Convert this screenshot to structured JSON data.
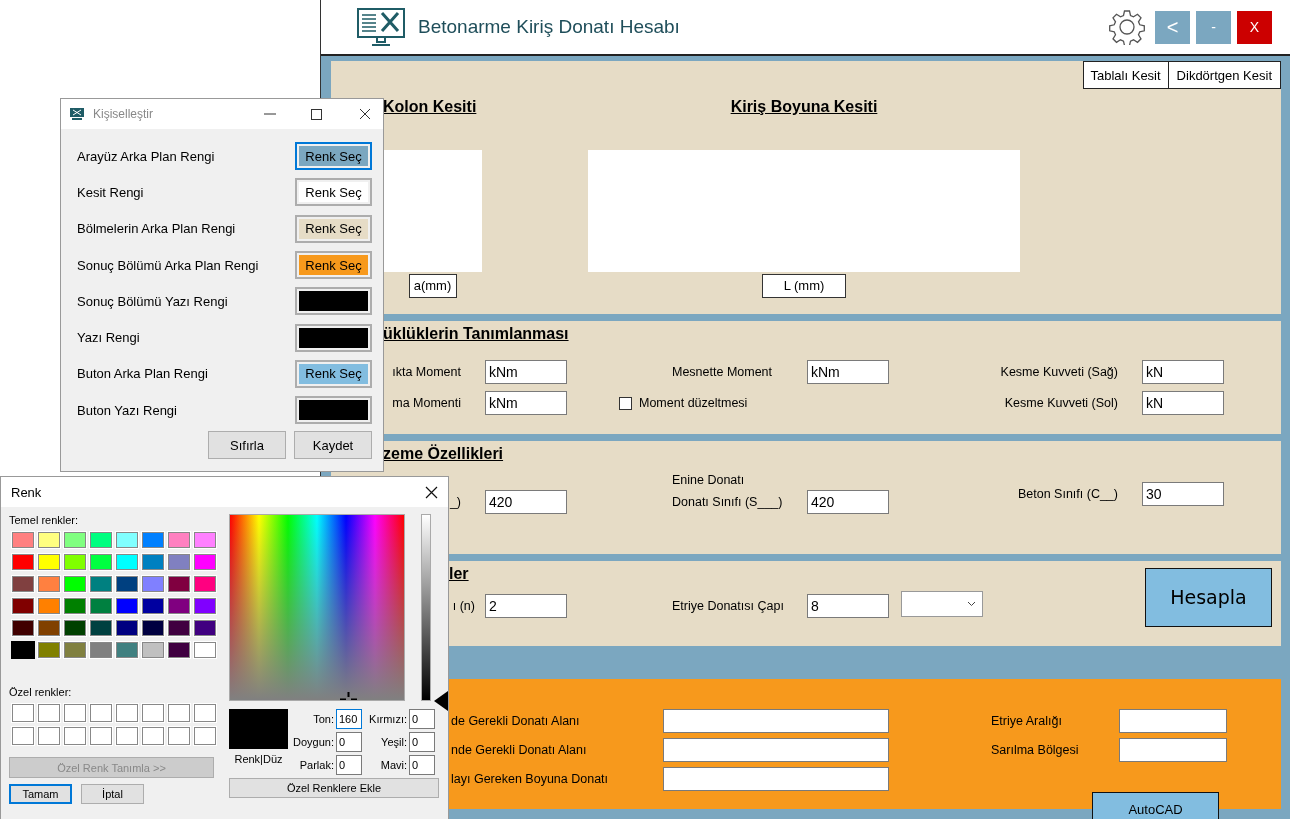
{
  "main_window": {
    "title": "Betonarme Kiriş Donatı Hesabı",
    "window_buttons": [
      {
        "kind": "back",
        "label": "<"
      },
      {
        "kind": "minimize",
        "label": "-"
      },
      {
        "kind": "close",
        "label": "X"
      }
    ],
    "section_types": [
      {
        "label": "Tablalı Kesit"
      },
      {
        "label": "Dikdörtgen Kesit"
      }
    ],
    "sections": {
      "column_title": "Kolon Kesiti",
      "column_dimension": "a(mm)",
      "beam_title": "Kiriş Boyuna Kesiti",
      "beam_dimension": "L (mm)"
    },
    "loads": {
      "title": "üklüklerin Tanımlanması",
      "span_moment": {
        "label": "ıkta Moment",
        "value": "kNm"
      },
      "torsion_moment": {
        "label": "ma Momenti",
        "value": "kNm"
      },
      "support_moment": {
        "label": "Mesnette Moment",
        "value": "kNm"
      },
      "shear_right": {
        "label": "Kesme Kuvveti (Sağ)",
        "value": "kN"
      },
      "shear_left": {
        "label": "Kesme Kuvveti (Sol)",
        "value": "kN"
      },
      "moment_correction": {
        "label": "Moment düzeltmesi",
        "checked": false
      }
    },
    "materials": {
      "title": "zeme Özellikleri",
      "longitudinal": {
        "label": "_)",
        "value": "420"
      },
      "transverse_heading": "Enine Donatı",
      "transverse": {
        "label": "Donatı Sınıfı (S___)",
        "value": "420"
      },
      "concrete": {
        "label": "Beton Sınıfı (C__)",
        "value": "30"
      }
    },
    "rebars": {
      "title": "ler",
      "count": {
        "label": "ı (n)",
        "value": "2"
      },
      "stirrup_diameter": {
        "label": "Etriye Donatısı Çapı",
        "value": "8"
      },
      "calculate_button": "Hesapla"
    },
    "results": {
      "labels": [
        "de Gerekli Donatı Alanı",
        "nde Gerekli Donatı Alanı",
        "layı Gereken Boyuna Donatı"
      ],
      "right_labels": [
        "Etriye Aralığı",
        "Sarılma Bölgesi"
      ],
      "autocad_button": "AutoCAD"
    }
  },
  "customize_dialog": {
    "title": "Kişiselleştir",
    "rows": [
      {
        "label": "Arayüz Arka Plan Rengi",
        "button": "Renk Seç",
        "color": "#7ba7c0",
        "focused": true
      },
      {
        "label": "Kesit Rengi",
        "button": "Renk Seç",
        "color": "#ffffff",
        "focused": false
      },
      {
        "label": "Bölmelerin Arka Plan Rengi",
        "button": "Renk Seç",
        "color": "#e6dcc6",
        "focused": false
      },
      {
        "label": "Sonuç Bölümü Arka Plan Rengi",
        "button": "Renk Seç",
        "color": "#f7991c",
        "focused": false
      },
      {
        "label": "Sonuç Bölümü Yazı Rengi",
        "color": "#000000",
        "focused": false
      },
      {
        "label": "Yazı Rengi",
        "color": "#000000",
        "focused": false
      },
      {
        "label": "Buton Arka Plan Rengi",
        "button": "Renk Seç",
        "color": "#82bde0",
        "focused": false
      },
      {
        "label": "Buton Yazı Rengi",
        "color": "#000000",
        "focused": false
      }
    ],
    "buttons": [
      "Sıfırla",
      "Kaydet"
    ]
  },
  "color_dialog": {
    "title": "Renk",
    "basic_label": "Temel renkler:",
    "basic_colors": [
      {
        "color": "#ff8080",
        "selected": false
      },
      {
        "color": "#ffff80",
        "selected": false
      },
      {
        "color": "#80ff80",
        "selected": false
      },
      {
        "color": "#00ff80",
        "selected": false
      },
      {
        "color": "#80ffff",
        "selected": false
      },
      {
        "color": "#0080ff",
        "selected": false
      },
      {
        "color": "#ff80c0",
        "selected": false
      },
      {
        "color": "#ff80ff",
        "selected": false
      },
      {
        "color": "#ff0000",
        "selected": false
      },
      {
        "color": "#ffff00",
        "selected": false
      },
      {
        "color": "#80ff00",
        "selected": false
      },
      {
        "color": "#00ff40",
        "selected": false
      },
      {
        "color": "#00ffff",
        "selected": false
      },
      {
        "color": "#0080c0",
        "selected": false
      },
      {
        "color": "#8080c0",
        "selected": false
      },
      {
        "color": "#ff00ff",
        "selected": false
      },
      {
        "color": "#804040",
        "selected": false
      },
      {
        "color": "#ff8040",
        "selected": false
      },
      {
        "color": "#00ff00",
        "selected": false
      },
      {
        "color": "#008080",
        "selected": false
      },
      {
        "color": "#004080",
        "selected": false
      },
      {
        "color": "#8080ff",
        "selected": false
      },
      {
        "color": "#800040",
        "selected": false
      },
      {
        "color": "#ff0080",
        "selected": false
      },
      {
        "color": "#800000",
        "selected": false
      },
      {
        "color": "#ff8000",
        "selected": false
      },
      {
        "color": "#008000",
        "selected": false
      },
      {
        "color": "#008040",
        "selected": false
      },
      {
        "color": "#0000ff",
        "selected": false
      },
      {
        "color": "#0000a0",
        "selected": false
      },
      {
        "color": "#800080",
        "selected": false
      },
      {
        "color": "#8000ff",
        "selected": false
      },
      {
        "color": "#400000",
        "selected": false
      },
      {
        "color": "#804000",
        "selected": false
      },
      {
        "color": "#004000",
        "selected": false
      },
      {
        "color": "#004040",
        "selected": false
      },
      {
        "color": "#000080",
        "selected": false
      },
      {
        "color": "#000040",
        "selected": false
      },
      {
        "color": "#400040",
        "selected": false
      },
      {
        "color": "#400080",
        "selected": false
      },
      {
        "color": "#000000",
        "selected": true
      },
      {
        "color": "#808000",
        "selected": false
      },
      {
        "color": "#808040",
        "selected": false
      },
      {
        "color": "#808080",
        "selected": false
      },
      {
        "color": "#408080",
        "selected": false
      },
      {
        "color": "#c0c0c0",
        "selected": false
      },
      {
        "color": "#400041",
        "selected": false
      },
      {
        "color": "#ffffff",
        "selected": false
      }
    ],
    "custom_label": "Özel renkler:",
    "custom_colors": [
      {
        "color": "#ffffff"
      },
      {
        "color": "#ffffff"
      },
      {
        "color": "#ffffff"
      },
      {
        "color": "#ffffff"
      },
      {
        "color": "#ffffff"
      },
      {
        "color": "#ffffff"
      },
      {
        "color": "#ffffff"
      },
      {
        "color": "#ffffff"
      },
      {
        "color": "#ffffff"
      },
      {
        "color": "#ffffff"
      },
      {
        "color": "#ffffff"
      },
      {
        "color": "#ffffff"
      },
      {
        "color": "#ffffff"
      },
      {
        "color": "#ffffff"
      },
      {
        "color": "#ffffff"
      },
      {
        "color": "#ffffff"
      }
    ],
    "define_button": {
      "label": "Özel Renk Tanımla >>",
      "disabled": true
    },
    "ok_button": "Tamam",
    "cancel_button": "İptal",
    "preview": {
      "label": "Renk|Düz",
      "color": "#000000"
    },
    "fields": [
      {
        "label": "Ton:",
        "value": "160"
      },
      {
        "label": "Kırmızı:",
        "value": "0"
      },
      {
        "label": "Doygun:",
        "value": "0"
      },
      {
        "label": "Yeşil:",
        "value": "0"
      },
      {
        "label": "Parlak:",
        "value": "0"
      },
      {
        "label": "Mavi:",
        "value": "0"
      }
    ],
    "add_button": "Özel Renklere Ekle"
  }
}
